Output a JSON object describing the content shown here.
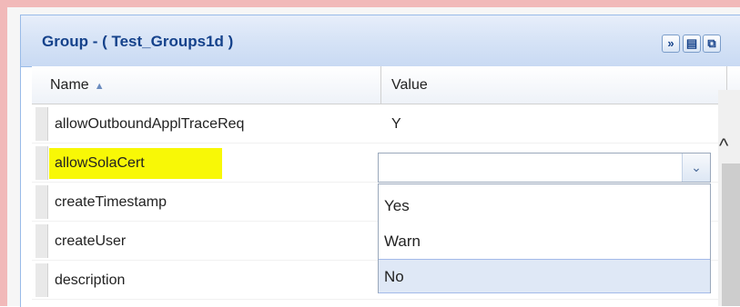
{
  "panel": {
    "title": "Group - ( Test_Groups1d )",
    "tools": [
      "expand-icon",
      "save-icon",
      "restore-icon"
    ],
    "tool_glyphs": {
      "expand": "»",
      "save": "▤",
      "restore": "⧉"
    }
  },
  "grid": {
    "columns": {
      "name": "Name",
      "value": "Value"
    },
    "sort_indicator": "▲",
    "rows": [
      {
        "name": "allowOutboundApplTraceReq",
        "value": "Y"
      },
      {
        "name": "allowSolaCert",
        "value": "",
        "highlighted": true
      },
      {
        "name": "createTimestamp",
        "value": ""
      },
      {
        "name": "createUser",
        "value": ""
      },
      {
        "name": "description",
        "value": ""
      }
    ]
  },
  "editor": {
    "value": "",
    "trigger_glyph": "⌄",
    "options": [
      "Yes",
      "Warn",
      "No"
    ],
    "hovered_option": "No"
  },
  "scrollbar": {
    "up_glyph": "^"
  },
  "colors": {
    "highlight": "#f8f806",
    "title": "#15428b",
    "hover": "#dfe8f6",
    "frame": "#f1b9b9"
  }
}
